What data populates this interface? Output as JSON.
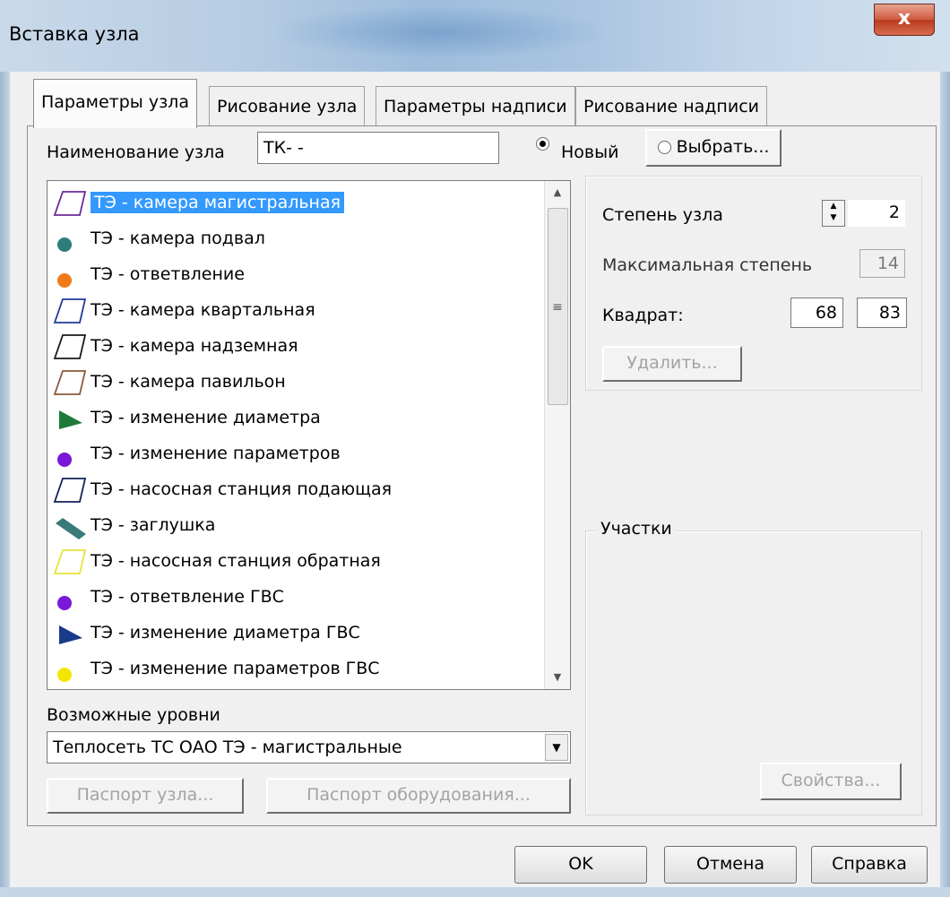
{
  "window": {
    "title": "Вставка узла",
    "close_label": "x"
  },
  "tabs": [
    {
      "label": "Параметры узла",
      "active": true
    },
    {
      "label": "Рисование узла",
      "active": false
    },
    {
      "label": "Параметры надписи",
      "active": false
    },
    {
      "label": "Рисование надписи",
      "active": false
    }
  ],
  "node_name": {
    "label": "Наименование узла",
    "value": "ТК-   -"
  },
  "mode": {
    "new_label": "Новый",
    "new_checked": true,
    "select_label": "Выбрать...",
    "select_checked": false
  },
  "node_types": [
    {
      "label": "ТЭ - камера магистральная",
      "icon": "parallelogram-outline-icon",
      "color": "#6a2a9a",
      "selected": true
    },
    {
      "label": "ТЭ - камера подвал",
      "icon": "dot-icon",
      "color": "#2e7d7a"
    },
    {
      "label": "ТЭ - ответвление",
      "icon": "dot-icon",
      "color": "#f07a1a"
    },
    {
      "label": "ТЭ - камера квартальная",
      "icon": "parallelogram-outline-icon",
      "color": "#1f3a9a"
    },
    {
      "label": "ТЭ - камера надземная",
      "icon": "parallelogram-outline-icon",
      "color": "#1a1a1a"
    },
    {
      "label": "ТЭ - камера павильон",
      "icon": "parallelogram-outline-icon",
      "color": "#8a5a3a"
    },
    {
      "label": "ТЭ - изменение диаметра",
      "icon": "triangle-icon",
      "color": "#1f7a3a"
    },
    {
      "label": "ТЭ - изменение параметров",
      "icon": "dot-icon",
      "color": "#7a18d8"
    },
    {
      "label": "ТЭ - насосная станция подающая",
      "icon": "parallelogram-outline-icon",
      "color": "#12225a"
    },
    {
      "label": "ТЭ - заглушка",
      "icon": "bar-icon",
      "color": "#3a7a7a"
    },
    {
      "label": "ТЭ - насосная станция обратная",
      "icon": "parallelogram-outline-icon",
      "color": "#e4e43a"
    },
    {
      "label": "ТЭ - ответвление ГВС",
      "icon": "dot-icon",
      "color": "#7a18d8"
    },
    {
      "label": "ТЭ - изменение диаметра ГВС",
      "icon": "triangle-icon",
      "color": "#1a3a8a"
    },
    {
      "label": "ТЭ - изменение параметров ГВС",
      "icon": "dot-icon",
      "color": "#f2e600"
    }
  ],
  "levels": {
    "label": "Возможные уровни",
    "value": "Теплосеть ТС ОАО ТЭ - магистральные"
  },
  "left_buttons": {
    "passport_node": "Паспорт узла...",
    "passport_equipment": "Паспорт оборудования..."
  },
  "params": {
    "degree_label": "Степень узла",
    "degree_value": "2",
    "max_degree_label": "Максимальная степень",
    "max_degree_value": "14",
    "square_label": "Квадрат:",
    "square_x": "68",
    "square_y": "83",
    "delete_label": "Удалить..."
  },
  "sections": {
    "title": "Участки",
    "properties_label": "Свойства..."
  },
  "dialog_buttons": {
    "ok": "OK",
    "cancel": "Отмена",
    "help": "Справка"
  }
}
